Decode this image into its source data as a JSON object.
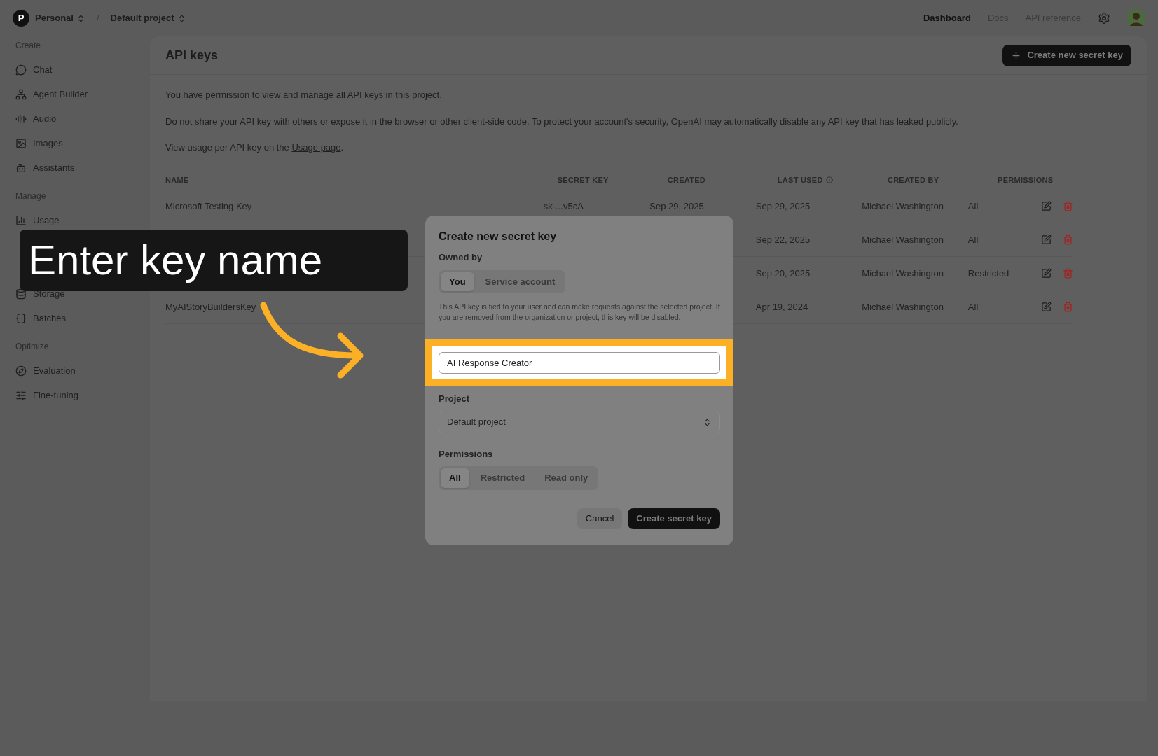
{
  "topbar": {
    "org_initial": "P",
    "org": "Personal",
    "separator": "/",
    "project": "Default project",
    "nav": [
      {
        "label": "Dashboard",
        "selected": true
      },
      {
        "label": "Docs",
        "selected": false
      },
      {
        "label": "API reference",
        "selected": false
      }
    ]
  },
  "sidebar": {
    "sections": [
      {
        "title": "Create",
        "items": [
          {
            "label": "Chat"
          },
          {
            "label": "Agent Builder"
          },
          {
            "label": "Audio"
          },
          {
            "label": "Images"
          },
          {
            "label": "Assistants"
          }
        ]
      },
      {
        "title": "Manage",
        "items": [
          {
            "label": "Usage"
          },
          {
            "label": "Storage"
          },
          {
            "label": "Batches"
          }
        ]
      },
      {
        "title": "Optimize",
        "items": [
          {
            "label": "Evaluation"
          },
          {
            "label": "Fine-tuning"
          }
        ]
      }
    ]
  },
  "page": {
    "title": "API keys",
    "create_button": "Create new secret key",
    "notes": [
      "You have permission to view and manage all API keys in this project.",
      "Do not share your API key with others or expose it in the browser or other client-side code. To protect your account's security, OpenAI may automatically disable any API key that has leaked publicly."
    ],
    "usage_note": {
      "before": "View usage per API key on the ",
      "link": "Usage page",
      "after": "."
    }
  },
  "table": {
    "columns": [
      "NAME",
      "SECRET KEY",
      "CREATED",
      "LAST USED",
      "CREATED BY",
      "PERMISSIONS"
    ],
    "rows": [
      {
        "name": "Microsoft Testing Key",
        "secret_key": "sk-...v5cA",
        "created": "Sep 29, 2025",
        "last_used": "Sep 29, 2025",
        "created_by": "Michael Washington",
        "permissions": "All"
      },
      {
        "last_used": "Sep 22, 2025",
        "created_by": "Michael Washington",
        "permissions": "All"
      },
      {
        "last_used": "Sep 20, 2025",
        "created_by": "Michael Washington",
        "permissions": "Restricted"
      },
      {
        "name": "MyAIStoryBuildersKey",
        "last_used": "Apr 19, 2024",
        "created_by": "Michael Washington",
        "permissions": "All"
      }
    ]
  },
  "dialog": {
    "title": "Create new secret key",
    "owned_by_label": "Owned by",
    "owners": [
      {
        "label": "You",
        "selected": true
      },
      {
        "label": "Service account",
        "selected": false
      }
    ],
    "owner_note": "This API key is tied to your user and can make requests against the selected project. If you are removed from the organization or project, this key will be disabled.",
    "name_value": "AI Response Creator",
    "project_label": "Project",
    "project_value": "Default project",
    "permissions_label": "Permissions",
    "permissions": [
      {
        "label": "All",
        "selected": true
      },
      {
        "label": "Restricted",
        "selected": false
      },
      {
        "label": "Read only",
        "selected": false
      }
    ],
    "cancel": "Cancel",
    "submit": "Create secret key"
  },
  "callout": {
    "text": "Enter key name"
  }
}
